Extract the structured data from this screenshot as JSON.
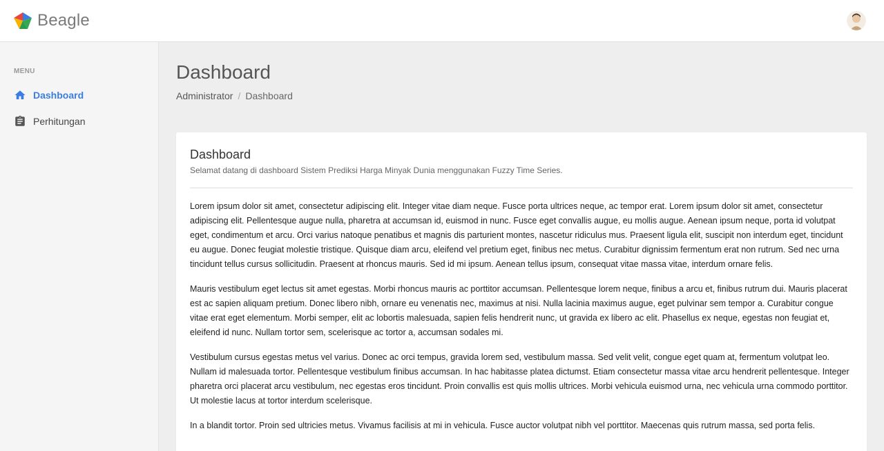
{
  "app": {
    "name": "Beagle",
    "colors": {
      "accent": "#3b7de0",
      "logo_red": "#e8453c",
      "logo_blue": "#3b7de0",
      "logo_green": "#34a853",
      "logo_yellow": "#f4b400"
    }
  },
  "header": {
    "avatar_icon": "user-avatar"
  },
  "sidebar": {
    "menu_header": "MENU",
    "items": [
      {
        "label": "Dashboard",
        "icon": "home-icon",
        "active": true
      },
      {
        "label": "Perhitungan",
        "icon": "clipboard-icon",
        "active": false
      }
    ]
  },
  "page": {
    "title": "Dashboard",
    "breadcrumb": {
      "parent": "Administrator",
      "separator": "/",
      "current": "Dashboard"
    }
  },
  "card": {
    "title": "Dashboard",
    "subtitle": "Selamat datang di dashboard Sistem Prediksi Harga Minyak Dunia menggunakan Fuzzy Time Series.",
    "paragraphs": [
      "Lorem ipsum dolor sit amet, consectetur adipiscing elit. Integer vitae diam neque. Fusce porta ultrices neque, ac tempor erat. Lorem ipsum dolor sit amet, consectetur adipiscing elit. Pellentesque augue nulla, pharetra at accumsan id, euismod in nunc. Fusce eget convallis augue, eu mollis augue. Aenean ipsum neque, porta id volutpat eget, condimentum et arcu. Orci varius natoque penatibus et magnis dis parturient montes, nascetur ridiculus mus. Praesent ligula elit, suscipit non interdum eget, tincidunt eu augue. Donec feugiat molestie tristique. Quisque diam arcu, eleifend vel pretium eget, finibus nec metus. Curabitur dignissim fermentum erat non rutrum. Sed nec urna tincidunt tellus cursus sollicitudin. Praesent at rhoncus mauris. Sed id mi ipsum. Aenean tellus ipsum, consequat vitae massa vitae, interdum ornare felis.",
      "Mauris vestibulum eget lectus sit amet egestas. Morbi rhoncus mauris ac porttitor accumsan. Pellentesque lorem neque, finibus a arcu et, finibus rutrum dui. Mauris placerat est ac sapien aliquam pretium. Donec libero nibh, ornare eu venenatis nec, maximus at nisi. Nulla lacinia maximus augue, eget pulvinar sem tempor a. Curabitur congue vitae erat eget elementum. Morbi semper, elit ac lobortis malesuada, sapien felis hendrerit nunc, ut gravida ex libero ac elit. Phasellus ex neque, egestas non feugiat et, eleifend id nunc. Nullam tortor sem, scelerisque ac tortor a, accumsan sodales mi.",
      "Vestibulum cursus egestas metus vel varius. Donec ac orci tempus, gravida lorem sed, vestibulum massa. Sed velit velit, congue eget quam at, fermentum volutpat leo. Nullam id malesuada tortor. Pellentesque vestibulum finibus accumsan. In hac habitasse platea dictumst. Etiam consectetur massa vitae arcu hendrerit pellentesque. Integer pharetra orci placerat arcu vestibulum, nec egestas eros tincidunt. Proin convallis est quis mollis ultrices. Morbi vehicula euismod urna, nec vehicula urna commodo porttitor. Ut molestie lacus at tortor interdum scelerisque.",
      "In a blandit tortor. Proin sed ultricies metus. Vivamus facilisis at mi in vehicula. Fusce auctor volutpat nibh vel porttitor. Maecenas quis rutrum massa, sed porta felis."
    ]
  }
}
